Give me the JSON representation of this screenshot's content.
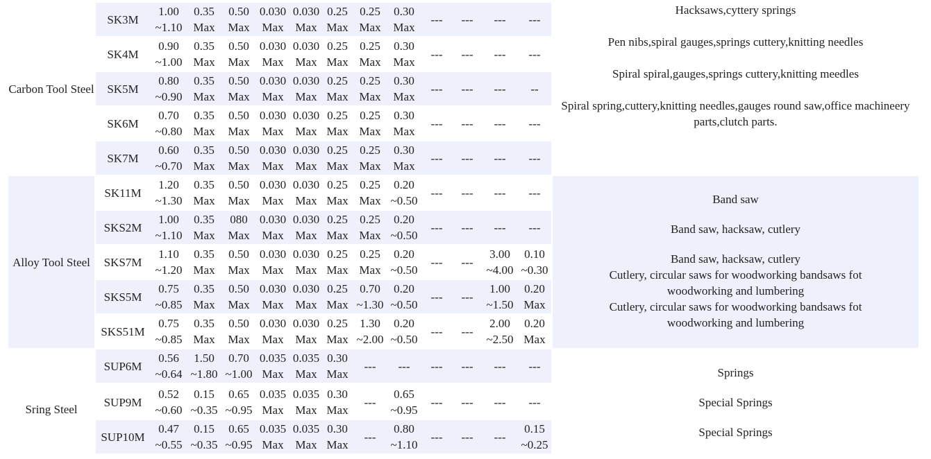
{
  "groups": [
    {
      "label": "Carbon Tool Steel",
      "rows": [
        {
          "grade": "SK3M",
          "cells": [
            "1.00\n~1.10",
            "0.35\nMax",
            "0.50\nMax",
            "0.030\nMax",
            "0.030\nMax",
            "0.25\nMax",
            "0.25\nMax",
            "0.30\nMax",
            "---",
            "---",
            "---",
            "---"
          ]
        },
        {
          "grade": "SK4M",
          "cells": [
            "0.90\n~1.00",
            "0.35\nMax",
            "0.50\nMax",
            "0.030\nMax",
            "0.030\nMax",
            "0.25\nMax",
            "0.25\nMax",
            "0.30\nMax",
            "---",
            "---",
            "---",
            "---"
          ]
        },
        {
          "grade": "SK5M",
          "cells": [
            "0.80\n~0.90",
            "0.35\nMax",
            "0.50\nMax",
            "0.030\nMax",
            "0.030\nMax",
            "0.25\nMax",
            "0.25\nMax",
            "0.30\nMax",
            "---",
            "---",
            "---",
            "--"
          ]
        },
        {
          "grade": "SK6M",
          "cells": [
            "0.70\n~0.80",
            "0.35\nMax",
            "0.50\nMax",
            "0.030\nMax",
            "0.030\nMax",
            "0.25\nMax",
            "0.25\nMax",
            "0.30\nMax",
            "---",
            "---",
            "---",
            "---"
          ]
        },
        {
          "grade": "SK7M",
          "cells": [
            "0.60\n~0.70",
            "0.35\nMax",
            "0.50\nMax",
            "0.030\nMax",
            "0.030\nMax",
            "0.25\nMax",
            "0.25\nMax",
            "0.30\nMax",
            "---",
            "---",
            "---",
            "---"
          ]
        }
      ],
      "applications": [
        "Hacksaws,cyttery springs",
        "Pen nibs,spiral gauges,springs cuttery,knitting needles",
        "Spiral spiral,gauges,springs cuttery,knitting meedles",
        "Spiral spring,cuttery,knitting needles,gauges round saw,office machineery parts,clutch parts."
      ]
    },
    {
      "label": "Alloy Tool Steel",
      "rows": [
        {
          "grade": "SK11M",
          "cells": [
            "1.20\n~1.30",
            "0.35\nMax",
            "0.50\nMax",
            "0.030\nMax",
            "0.030\nMax",
            "0.25\nMax",
            "0.25\nMax",
            "0.20\n~0.50",
            "---",
            "---",
            "---",
            "---"
          ]
        },
        {
          "grade": "SKS2M",
          "cells": [
            "1.00\n~1.10",
            "0.35\nMax",
            "080\nMax",
            "0.030\nMax",
            "0.030\nMax",
            "0.25\nMax",
            "0.25\nMax",
            "0.20\n~0.50",
            "---",
            "---",
            "---",
            "---"
          ]
        },
        {
          "grade": "SKS7M",
          "cells": [
            "1.10\n~1.20",
            "0.35\nMax",
            "0.50\nMax",
            "0.030\nMax",
            "0.030\nMax",
            "0.25\nMax",
            "0.25\nMax",
            "0.20\n~0.50",
            "---",
            "---",
            "3.00\n~4.00",
            "0.10\n~0.30"
          ]
        },
        {
          "grade": "SKS5M",
          "cells": [
            "0.75\n~0.85",
            "0.35\nMax",
            "0.50\nMax",
            "0.030\nMax",
            "0.030\nMax",
            "0.25\nMax",
            "0.70\n~1.30",
            "0.20\n~0.50",
            "---",
            "---",
            "1.00\n~1.50",
            "0.20\nMax"
          ]
        },
        {
          "grade": "SKS51M",
          "cells": [
            "0.75\n~0.85",
            "0.35\nMax",
            "0.50\nMax",
            "0.030\nMax",
            "0.030\nMax",
            "0.25\nMax",
            "1.30\n~2.00",
            "0.20\n~0.50",
            "---",
            "---",
            "2.00\n~2.50",
            "0.20\nMax"
          ]
        }
      ],
      "applications": [
        "Band saw",
        "Band saw, hacksaw, cutlery",
        "Band saw, hacksaw, cutlery",
        "Cutlery, circular saws for woodworking bandsaws fot woodworking and lumbering",
        "Cutlery, circular saws for woodworking bandsaws fot woodworking and lumbering"
      ]
    },
    {
      "label": "Sring Steel",
      "rows": [
        {
          "grade": "SUP6M",
          "cells": [
            "0.56\n~0.64",
            "1.50\n~1.80",
            "0.70\n~1.00",
            "0.035\nMax",
            "0.035\nMax",
            "0.30\nMax",
            "---",
            "---",
            "---",
            "---",
            "---",
            "---"
          ]
        },
        {
          "grade": "SUP9M",
          "cells": [
            "0.52\n~0.60",
            "0.15\n~0.35",
            "0.65\n~0.95",
            "0.035\nMax",
            "0.035\nMax",
            "0.30\nMax",
            "---",
            "0.65\n~0.95",
            "---",
            "---",
            "---",
            "---"
          ]
        },
        {
          "grade": "SUP10M",
          "cells": [
            "0.47\n~0.55",
            "0.15\n~0.35",
            "0.65\n~0.95",
            "0.035\nMax",
            "0.035\nMax",
            "0.30\nMax",
            "---",
            "0.80\n~1.10",
            "---",
            "---",
            "---",
            "0.15\n~0.25"
          ]
        }
      ],
      "applications": [
        "Springs",
        "Special Springs",
        "Special Springs"
      ]
    }
  ]
}
